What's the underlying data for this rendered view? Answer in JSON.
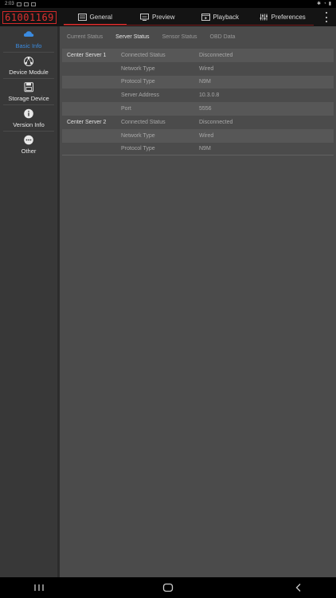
{
  "status_bar": {
    "time": "2:03"
  },
  "header": {
    "logo_text": "61001169",
    "tabs": [
      {
        "label": "General",
        "icon": "general-icon",
        "active": true
      },
      {
        "label": "Preview",
        "icon": "preview-icon",
        "active": false
      },
      {
        "label": "Playback",
        "icon": "playback-icon",
        "active": false
      },
      {
        "label": "Preferences",
        "icon": "preferences-icon",
        "active": false
      }
    ],
    "accent_color": "#e0302f"
  },
  "sidebar": {
    "items": [
      {
        "label": "Basic Info",
        "icon": "cloud-icon",
        "active": true
      },
      {
        "label": "Device Module",
        "icon": "device-module-icon",
        "active": false
      },
      {
        "label": "Storage Device",
        "icon": "floppy-disk-icon",
        "active": false
      },
      {
        "label": "Version Info",
        "icon": "info-icon",
        "active": false
      },
      {
        "label": "Other",
        "icon": "more-icon",
        "active": false
      }
    ],
    "active_color": "#3b8be0"
  },
  "subtabs": [
    {
      "label": "Current Status",
      "active": false
    },
    {
      "label": "Server Status",
      "active": true
    },
    {
      "label": "Sensor Status",
      "active": false
    },
    {
      "label": "OBD Data",
      "active": false
    }
  ],
  "server_table": [
    {
      "server": "Center Server 1",
      "field": "Connected Status",
      "value": "Disconnected"
    },
    {
      "server": "",
      "field": "Network Type",
      "value": "Wired"
    },
    {
      "server": "",
      "field": "Protocol Type",
      "value": "N9M"
    },
    {
      "server": "",
      "field": "Server Address",
      "value": "10.3.0.8"
    },
    {
      "server": "",
      "field": "Port",
      "value": "5556"
    },
    {
      "server": "Center Server 2",
      "field": "Connected Status",
      "value": "Disconnected"
    },
    {
      "server": "",
      "field": "Network Type",
      "value": "Wired"
    },
    {
      "server": "",
      "field": "Protocol Type",
      "value": "N9M"
    }
  ],
  "nav_bar": {
    "buttons": [
      "recent-apps-icon",
      "home-icon",
      "back-icon"
    ]
  }
}
